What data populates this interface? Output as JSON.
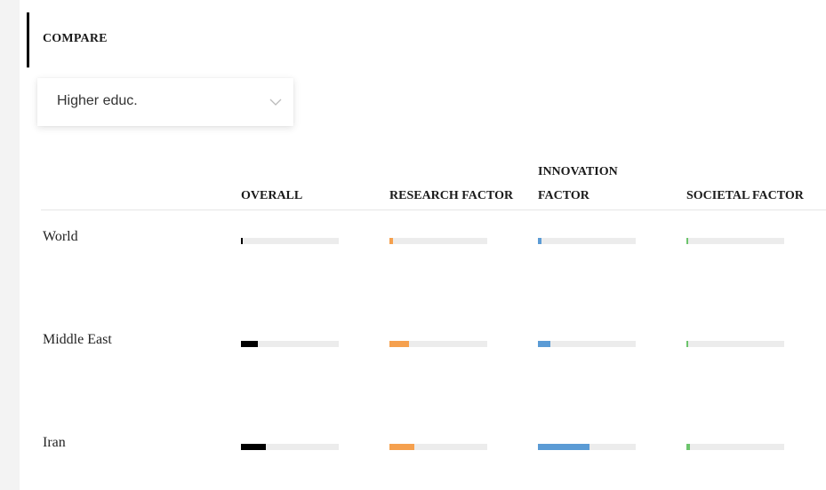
{
  "compare": {
    "label": "COMPARE"
  },
  "dropdown": {
    "selected": "Higher educ."
  },
  "columns": [
    {
      "label": "OVERALL",
      "color": "#000000"
    },
    {
      "label": "RESEARCH FACTOR",
      "color": "#f5a04e"
    },
    {
      "label": "INNOVATION FACTOR",
      "color": "#5b9bd5"
    },
    {
      "label": "SOCIETAL FACTOR",
      "color": "#6cc46c"
    }
  ],
  "rows": [
    {
      "label": "World",
      "values": [
        0.02,
        0.04,
        0.04,
        0.01
      ]
    },
    {
      "label": "Middle East",
      "values": [
        0.17,
        0.2,
        0.13,
        0.02
      ]
    },
    {
      "label": "Iran",
      "values": [
        0.25,
        0.25,
        0.53,
        0.04
      ]
    }
  ]
}
